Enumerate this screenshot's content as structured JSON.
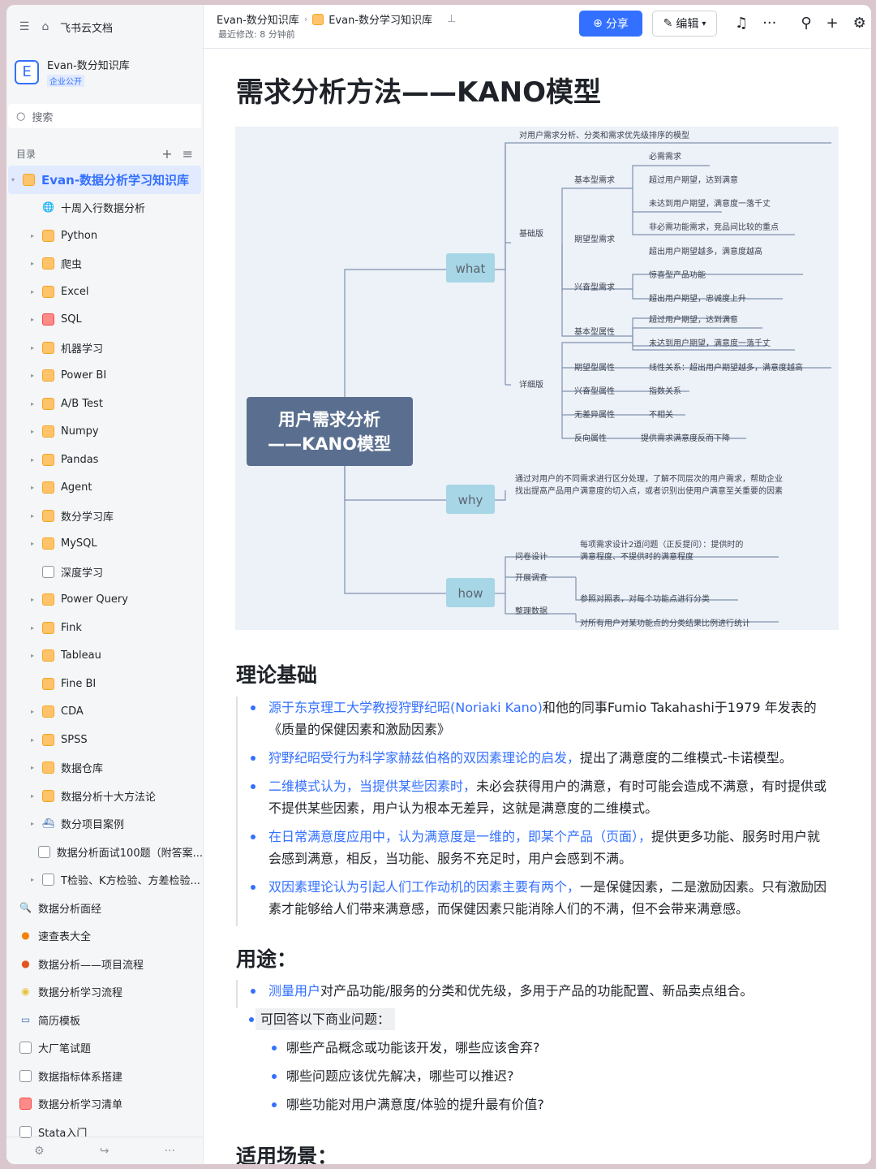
{
  "sidebar": {
    "app_title": "飞书云文档",
    "kb_logo": "E",
    "kb_name": "Evan-数分知识库",
    "kb_tag": "企业公开",
    "search_placeholder": "搜索",
    "toc_label": "目录",
    "active_item": "Evan-数据分析学习知识库",
    "items": [
      {
        "label": "十周入行数据分析",
        "arrow": "",
        "icon": "globe-icon"
      },
      {
        "label": "Python",
        "arrow": "▸",
        "icon": "folder-icon"
      },
      {
        "label": "爬虫",
        "arrow": "▸",
        "icon": "folder-icon"
      },
      {
        "label": "Excel",
        "arrow": "▸",
        "icon": "folder-icon"
      },
      {
        "label": "SQL",
        "arrow": "▸",
        "icon": "red-folder-icon"
      },
      {
        "label": "机器学习",
        "arrow": "▸",
        "icon": "folder-icon"
      },
      {
        "label": "Power BI",
        "arrow": "▸",
        "icon": "folder-icon"
      },
      {
        "label": "A/B Test",
        "arrow": "▸",
        "icon": "folder-icon"
      },
      {
        "label": "Numpy",
        "arrow": "▸",
        "icon": "folder-icon"
      },
      {
        "label": "Pandas",
        "arrow": "▸",
        "icon": "folder-icon"
      },
      {
        "label": "Agent",
        "arrow": "▸",
        "icon": "folder-icon"
      },
      {
        "label": "数分学习库",
        "arrow": "▸",
        "icon": "folder-icon"
      },
      {
        "label": "MySQL",
        "arrow": "▸",
        "icon": "folder-icon"
      },
      {
        "label": "深度学习",
        "arrow": "",
        "icon": "doc-icon"
      },
      {
        "label": "Power Query",
        "arrow": "▸",
        "icon": "folder-icon"
      },
      {
        "label": "Fink",
        "arrow": "▸",
        "icon": "folder-icon"
      },
      {
        "label": "Tableau",
        "arrow": "▸",
        "icon": "folder-icon"
      },
      {
        "label": "Fine BI",
        "arrow": "",
        "icon": "folder-icon"
      },
      {
        "label": "CDA",
        "arrow": "▸",
        "icon": "folder-icon"
      },
      {
        "label": "SPSS",
        "arrow": "▸",
        "icon": "folder-icon"
      },
      {
        "label": "数据仓库",
        "arrow": "▸",
        "icon": "folder-icon"
      },
      {
        "label": "数据分析十大方法论",
        "arrow": "▸",
        "icon": "folder-icon"
      },
      {
        "label": "数分项目案例",
        "arrow": "▸",
        "icon": "ship-icon"
      },
      {
        "label": "数据分析面试100题（附答案...",
        "arrow": "",
        "icon": "doc-icon"
      },
      {
        "label": "T检验、K方检验、方差检验...",
        "arrow": "▸",
        "icon": "doc-icon"
      },
      {
        "label": "数据分析面经",
        "arrow": "",
        "icon": "magnifier-icon",
        "top": true
      },
      {
        "label": "速查表大全",
        "arrow": "",
        "icon": "orange-icon",
        "top": true
      },
      {
        "label": "数据分析——项目流程",
        "arrow": "",
        "icon": "apple-icon",
        "top": true
      },
      {
        "label": "数据分析学习流程",
        "arrow": "",
        "icon": "egg-icon",
        "top": true
      },
      {
        "label": "简历模板",
        "arrow": "",
        "icon": "inbox-icon",
        "top": true
      },
      {
        "label": "大厂笔试题",
        "arrow": "",
        "icon": "doc-icon",
        "top": true
      },
      {
        "label": "数据指标体系搭建",
        "arrow": "",
        "icon": "doc-icon",
        "top": true
      },
      {
        "label": "数据分析学习清单",
        "arrow": "",
        "icon": "red-folder-icon",
        "top": true
      },
      {
        "label": "Stata入门",
        "arrow": "",
        "icon": "doc-icon",
        "top": true
      }
    ]
  },
  "header": {
    "breadcrumb": [
      "Evan-数分知识库",
      "Evan-数分学习知识库"
    ],
    "last_modified": "最近修改: 8 分钟前",
    "share_label": "分享",
    "edit_label": "编辑"
  },
  "doc": {
    "title": "需求分析方法——KANO模型",
    "mindmap": {
      "root_line1": "用户需求分析",
      "root_line2": "——KANO模型",
      "top_desc": "对用户需求分析、分类和需求优先级排序的模型",
      "what": "what",
      "why": "why",
      "how": "how",
      "basic": "基础版",
      "detail": "详细版",
      "b1": "基本型需求",
      "b1a": "必需需求",
      "b1b": "超过用户期望，达到满意",
      "b1c": "未达到用户期望，满意度一落千丈",
      "b2": "期望型需求",
      "b2a": "非必需功能需求，竞品间比较的重点",
      "b2b": "超出用户期望越多，满意度越高",
      "b3": "兴奋型需求",
      "b3a": "惊喜型产品功能",
      "b3b": "超出用户期望，忠诚度上升",
      "d1": "基本型属性",
      "d1a": "超过用户期望，达到满意",
      "d1b": "未达到用户期望，满意度一落千丈",
      "d2": "期望型属性",
      "d2a": "线性关系：超出用户期望越多，满意度越高",
      "d3": "兴奋型属性",
      "d3a": "指数关系",
      "d4": "无差异属性",
      "d4a": "不相关",
      "d5": "反向属性",
      "d5a": "提供需求满意度反而下降",
      "why1": "通过对用户的不同需求进行区分处理，了解不同层次的用户需求，帮助企业",
      "why2": "找出提高产品用户满意度的切入点，或者识别出使用户满意至关重要的因素",
      "h1": "问卷设计",
      "h1a": "每项需求设计2道问题（正反提问）：提供时的",
      "h1b": "满意程度、不提供时的满意程度",
      "h2": "开展调查",
      "h3": "整理数据",
      "h3a": "参照对照表，对每个功能点进行分类",
      "h3b": "对所有用户对某功能点的分类结果比例进行统计"
    },
    "section1_title": "理论基础",
    "section1": [
      {
        "hl": "源于东京理工大学教授狩野纪昭(Noriaki Kano)",
        "rest": "和他的同事Fumio Takahashi于1979 年发表的《质量的保健因素和激励因素》"
      },
      {
        "hl": "狩野纪昭受行为科学家赫兹伯格的双因素理论的启发，",
        "rest": "提出了满意度的二维模式-卡诺模型。"
      },
      {
        "hl": "二维模式认为，当提供某些因素时，",
        "rest": "未必会获得用户的满意，有时可能会造成不满意，有时提供或不提供某些因素，用户认为根本无差异，这就是满意度的二维模式。"
      },
      {
        "hl": "在日常满意度应用中，认为满意度是一维的，即某个产品（页面），",
        "rest": "提供更多功能、服务时用户就会感到满意，相反，当功能、服务不充足时，用户会感到不满。"
      },
      {
        "hl": "双因素理论认为引起人们工作动机的因素主要有两个，",
        "rest": "一是保健因素，二是激励因素。只有激励因素才能够给人们带来满意感，而保健因素只能消除人们的不满，但不会带来满意感。"
      }
    ],
    "section2_title": "用途：",
    "section2": [
      {
        "hl": "测量用户",
        "rest": "对产品功能/服务的分类和优先级，多用于产品的功能配置、新品卖点组合。"
      }
    ],
    "question_label": "可回答以下商业问题：",
    "questions": [
      "哪些产品概念或功能该开发，哪些应该舍弃?",
      "哪些问题应该优先解决，哪些可以推迟?",
      "哪些功能对用户满意度/体验的提升最有价值?"
    ],
    "section3_title": "适用场景："
  }
}
